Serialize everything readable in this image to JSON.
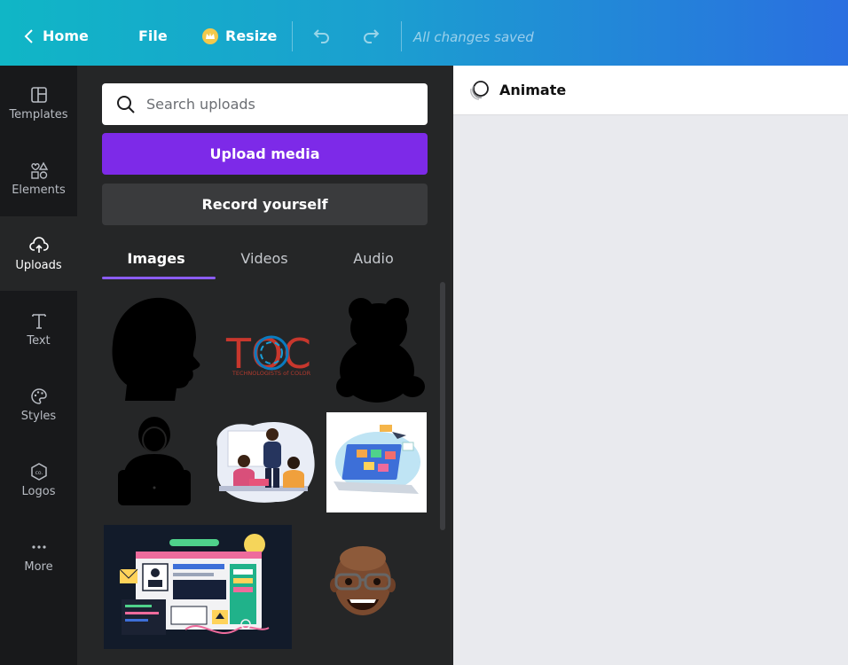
{
  "topbar": {
    "home_label": "Home",
    "file_label": "File",
    "resize_label": "Resize",
    "status_text": "All changes saved"
  },
  "rail": {
    "items": [
      {
        "label": "Templates",
        "icon": "templates-icon"
      },
      {
        "label": "Elements",
        "icon": "elements-icon"
      },
      {
        "label": "Uploads",
        "icon": "upload-cloud-icon"
      },
      {
        "label": "Text",
        "icon": "text-icon"
      },
      {
        "label": "Styles",
        "icon": "palette-icon"
      },
      {
        "label": "Logos",
        "icon": "logo-icon"
      },
      {
        "label": "More",
        "icon": "more-dots-icon"
      }
    ]
  },
  "panel": {
    "search_placeholder": "Search uploads",
    "upload_button": "Upload media",
    "record_button": "Record yourself",
    "tabs": [
      "Images",
      "Videos",
      "Audio"
    ]
  },
  "thumbs": {
    "toc_letters": "TOC",
    "toc_tagline": "TECHNOLOGISTS of COLOR"
  },
  "canvas": {
    "animate_label": "Animate"
  },
  "colors": {
    "accent_purple": "#7d2ae8",
    "panel_bg": "#252627",
    "rail_bg": "#18191b",
    "tab_underline": "#8b5cf6"
  }
}
